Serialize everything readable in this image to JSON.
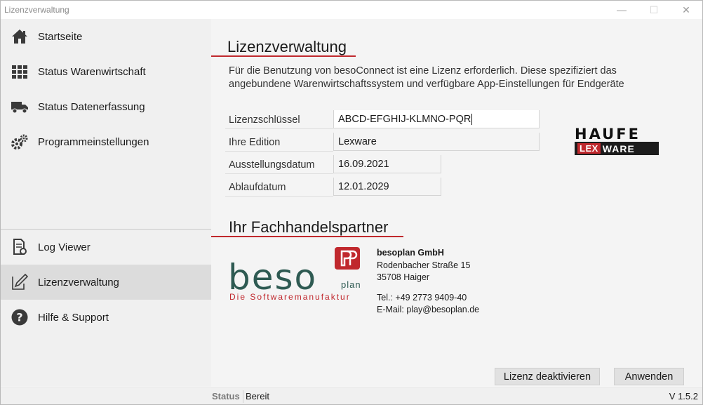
{
  "window": {
    "title": "Lizenzverwaltung",
    "minimize": "—",
    "maximize": "☐",
    "close": "✕"
  },
  "sidebar": {
    "items": [
      {
        "label": "Startseite",
        "icon": "home-icon"
      },
      {
        "label": "Status Warenwirtschaft",
        "icon": "warehouse-icon"
      },
      {
        "label": "Status Datenerfassung",
        "icon": "truck-icon"
      },
      {
        "label": "Programmeinstellungen",
        "icon": "gears-icon"
      },
      {
        "label": "Log Viewer",
        "icon": "log-document-icon"
      },
      {
        "label": "Lizenzverwaltung",
        "icon": "license-edit-icon",
        "active": true
      },
      {
        "label": "Hilfe & Support",
        "icon": "help-icon"
      }
    ]
  },
  "license": {
    "heading": "Lizenzverwaltung",
    "description": "Für die Benutzung von besoConnect ist eine Lizenz erforderlich. Diese spezifiziert das angebundene Warenwirtschaftssystem und verfügbare App-Einstellungen für Endgeräte",
    "key_label": "Lizenzschlüssel",
    "key_value": "ABCD-EFGHIJ-KLMNO-PQR",
    "edition_label": "Ihre Edition",
    "edition_value": "Lexware",
    "issue_label": "Ausstellungsdatum",
    "issue_value": "16.09.2021",
    "expiry_label": "Ablaufdatum",
    "expiry_value": "12.01.2029"
  },
  "haufe_logo": {
    "top": "HAUFE",
    "lex": "LEX",
    "ware": "WARE"
  },
  "partner": {
    "heading": "Ihr Fachhandelspartner",
    "logo_text": "beso",
    "logo_plan": "plan",
    "logo_tagline": "Die Softwaremanufaktur",
    "name": "besoplan GmbH",
    "street": "Rodenbacher Straße 15",
    "city": "35708 Haiger",
    "phone": "Tel.: +49 2773 9409-40",
    "email": "E-Mail: play@besoplan.de"
  },
  "buttons": {
    "deactivate": "Lizenz deaktivieren",
    "apply": "Anwenden"
  },
  "status": {
    "label": "Status",
    "value": "Bereit",
    "version": "V 1.5.2"
  },
  "colors": {
    "accent": "#c0282d",
    "beso_green": "#2e5a52",
    "sidebar_bg": "#f0f0f0",
    "active_bg": "#dcdcdc"
  }
}
